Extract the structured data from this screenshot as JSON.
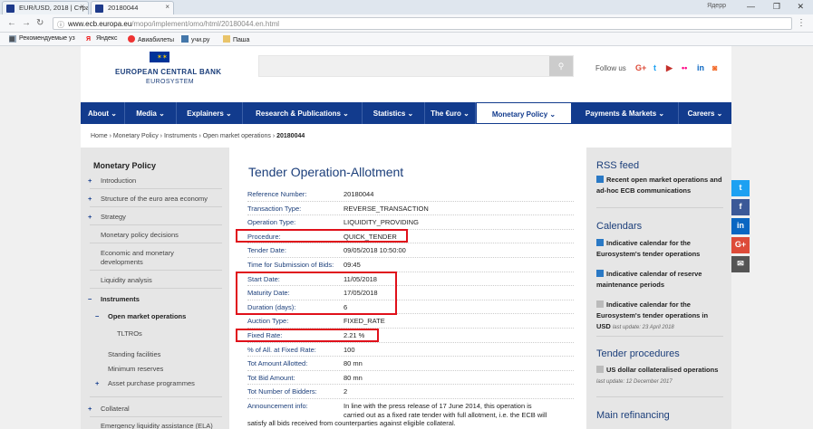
{
  "browser": {
    "tabs": [
      {
        "title": "EUR/USD, 2018 | Страни"
      },
      {
        "title": "20180044"
      }
    ],
    "user_label": "Ядерр",
    "url_host": "www.ecb.europa.eu",
    "url_path": "/mopo/implement/omo/html/20180044.en.html",
    "bookmarks": [
      "Рекомендуемые уз",
      "Яндекс",
      "Авиабилеты",
      "учи.ру",
      "Паша"
    ]
  },
  "site": {
    "logo_title": "EUROPEAN CENTRAL BANK",
    "logo_sub": "EUROSYSTEM",
    "follow_label": "Follow us",
    "nav": [
      "About",
      "Media",
      "Explainers",
      "Research & Publications",
      "Statistics",
      "The €uro",
      "Monetary Policy",
      "Payments & Markets",
      "Careers"
    ],
    "breadcrumb": [
      "Home",
      "Monetary Policy",
      "Instruments",
      "Open market operations",
      "20180044"
    ]
  },
  "sidebar": {
    "title": "Monetary Policy",
    "items": [
      "Introduction",
      "Structure of the euro area economy",
      "Strategy",
      "Monetary policy decisions",
      "Economic and monetary developments",
      "Liquidity analysis",
      "Instruments",
      "Open market operations",
      "TLTROs",
      "Standing facilities",
      "Minimum reserves",
      "Asset purchase programmes",
      "Collateral",
      "Emergency liquidity assistance (ELA)"
    ]
  },
  "content": {
    "title": "Tender Operation-Allotment",
    "rows": [
      {
        "k": "Reference Number:",
        "v": "20180044"
      },
      {
        "k": "Transaction Type:",
        "v": "REVERSE_TRANSACTION"
      },
      {
        "k": "Operation Type:",
        "v": "LIQUIDITY_PROVIDING"
      },
      {
        "k": "Procedure:",
        "v": "QUICK_TENDER"
      },
      {
        "k": "Tender Date:",
        "v": "09/05/2018 10:50:00"
      },
      {
        "k": "Time for Submission of Bids:",
        "v": "09:45"
      },
      {
        "k": "Start Date:",
        "v": "11/05/2018"
      },
      {
        "k": "Maturity Date:",
        "v": "17/05/2018"
      },
      {
        "k": "Duration (days):",
        "v": "6"
      },
      {
        "k": "Auction Type:",
        "v": "FIXED_RATE"
      },
      {
        "k": "Fixed Rate:",
        "v": "2.21 %"
      },
      {
        "k": "% of All. at Fixed Rate:",
        "v": "100"
      },
      {
        "k": "Tot Amount Allotted:",
        "v": "80 mn"
      },
      {
        "k": "Tot Bid Amount:",
        "v": "80 mn"
      },
      {
        "k": "Tot Number of Bidders:",
        "v": "2"
      }
    ],
    "announcement_label": "Announcement info:",
    "announcement_line1": "In line with the press release of 17 June 2014, this operation is",
    "announcement_line2": "carried out as a fixed rate tender with full allotment, i.e. the ECB will",
    "announcement_line3": "satisfy all bids received from counterparties against eligible collateral."
  },
  "right": {
    "rss_title": "RSS feed",
    "rss_link": "Recent open market operations and ad-hoc ECB communications",
    "cal_title": "Calendars",
    "cal_links": [
      {
        "text": "Indicative calendar for the Eurosystem's tender operations",
        "date": ""
      },
      {
        "text": "Indicative calendar of reserve maintenance periods",
        "date": ""
      },
      {
        "text": "Indicative calendar for the Eurosystem's tender operations in USD",
        "date": "last update: 23 April 2018"
      }
    ],
    "tp_title": "Tender procedures",
    "tp_link": "US dollar collateralised operations",
    "tp_date": "last update: 12 December 2017",
    "mr_title": "Main refinancing"
  },
  "share": [
    "t",
    "f",
    "in",
    "G+",
    "✉"
  ],
  "colors": {
    "ecb_blue": "#123b8d",
    "highlight_red": "#e0101a"
  }
}
